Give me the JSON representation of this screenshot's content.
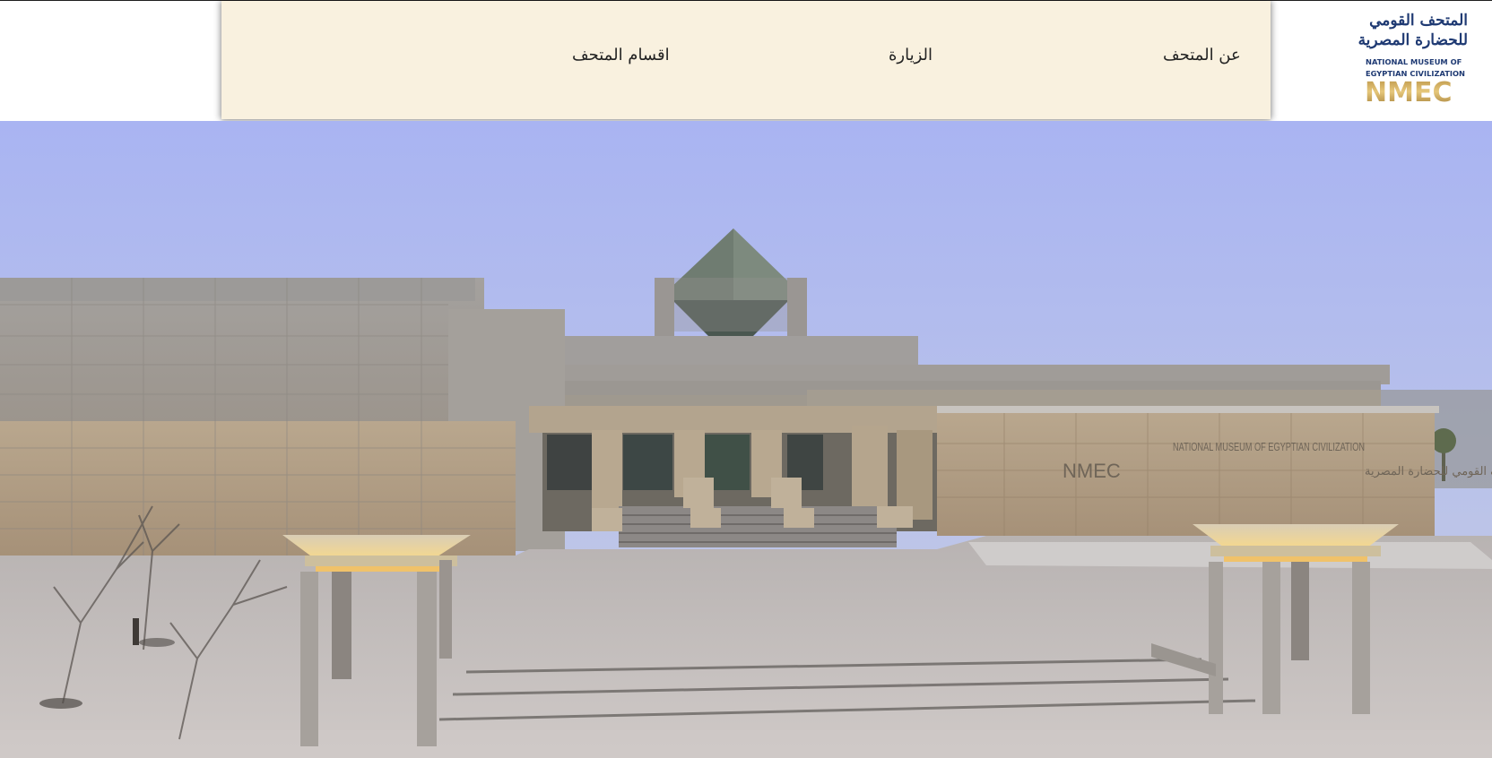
{
  "header": {
    "nav": {
      "about": "عن المتحف",
      "visit": "الزيارة",
      "sections": "اقسام المتحف"
    },
    "logo": {
      "arabic_line1": "المتحف القومي",
      "arabic_line2": "للحضارة المصرية",
      "english_line1": "NATIONAL MUSEUM OF",
      "english_line2": "EGYPTIAN CIVILIZATION",
      "abbreviation": "NMEC"
    }
  },
  "hero": {
    "image": "museum-building-exterior",
    "facade_sign_english": "NATIONAL MUSEUM OF EGYPTIAN CIVILIZATION",
    "facade_sign_abbr": "NMEC",
    "facade_sign_arabic": "المتحف القومي للحضارة المصرية"
  },
  "colors": {
    "nav_background": "#f9f1df",
    "logo_blue": "#1f3a73",
    "logo_gold": "#b99346",
    "sky_top": "#a9b5f0",
    "sky_bottom": "#c2cbe6"
  }
}
